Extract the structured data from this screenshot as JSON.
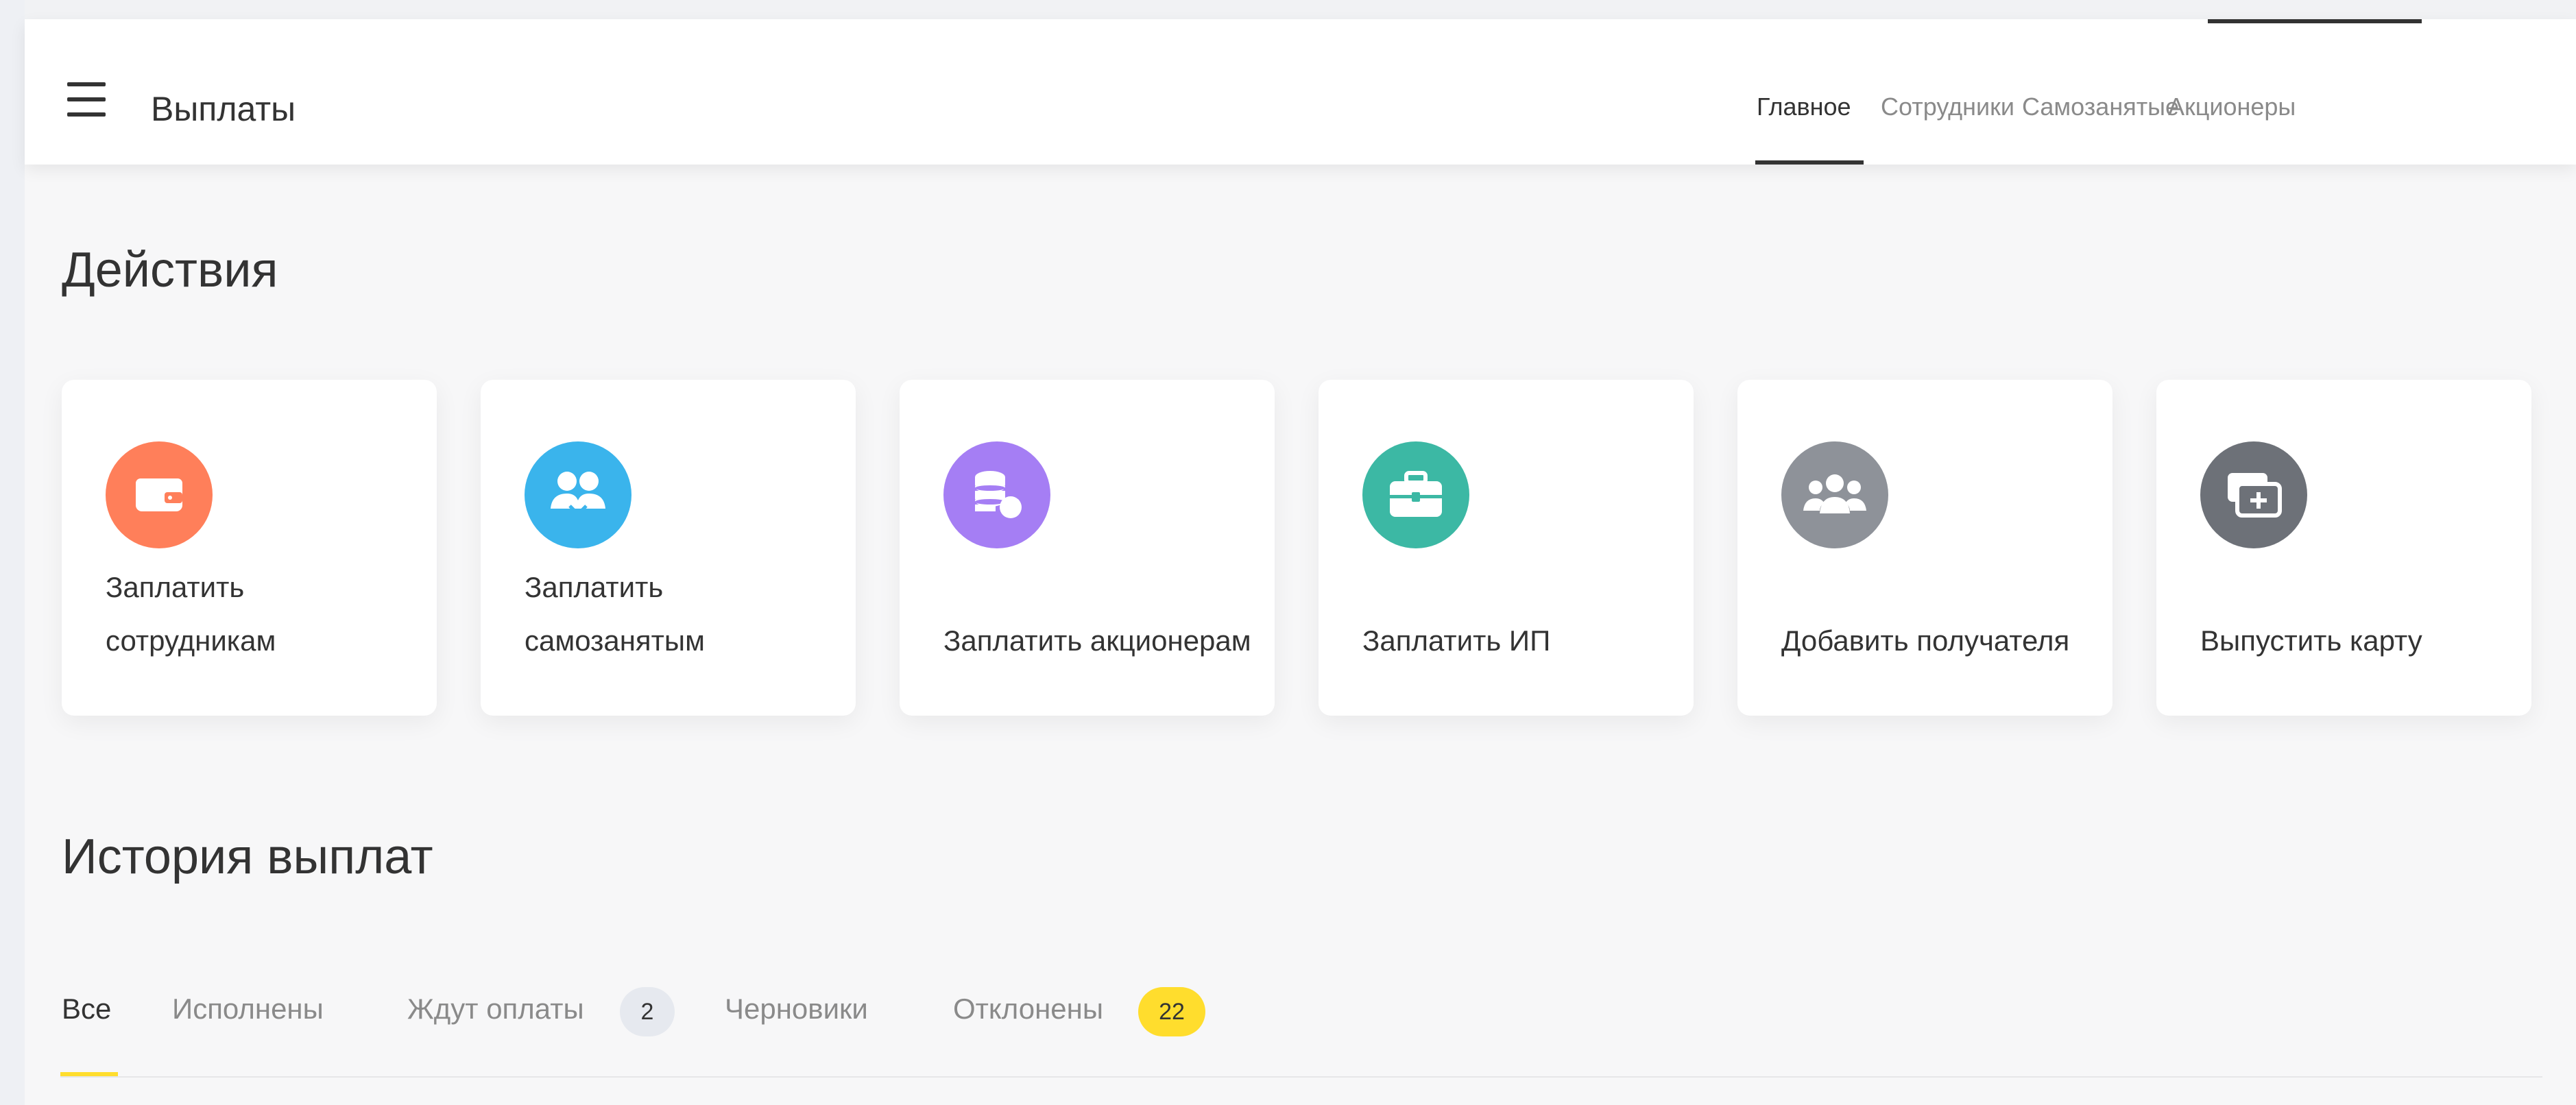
{
  "header": {
    "title": "Выплаты",
    "nav": [
      {
        "label": "Главное",
        "active": true
      },
      {
        "label": "Сотрудники",
        "active": false
      },
      {
        "label": "Самозанятые",
        "active": false
      },
      {
        "label": "Акционеры",
        "active": false
      }
    ]
  },
  "actions": {
    "title": "Действия",
    "cards": [
      {
        "label": "Заплатить сотрудникам",
        "icon": "wallet-icon",
        "color": "#ff7f5a"
      },
      {
        "label": "Заплатить самозанятым",
        "icon": "people-handshake-icon",
        "color": "#3ab4ec"
      },
      {
        "label": "Заплатить акционерам",
        "icon": "coins-stack-icon",
        "color": "#a57ef4"
      },
      {
        "label": "Заплатить ИП",
        "icon": "briefcase-icon",
        "color": "#3cb8a4"
      },
      {
        "label": "Добавить получателя",
        "icon": "group-icon",
        "color": "#8e9299"
      },
      {
        "label": "Выпустить карту",
        "icon": "add-card-icon",
        "color": "#6d7178"
      }
    ]
  },
  "history": {
    "title": "История выплат",
    "tabs": [
      {
        "label": "Все",
        "active": true
      },
      {
        "label": "Исполнены",
        "active": false
      },
      {
        "label": "Ждут оплаты",
        "active": false,
        "badge": "2",
        "badge_color": "#e6e9ef"
      },
      {
        "label": "Черновики",
        "active": false
      },
      {
        "label": "Отклонены",
        "active": false,
        "badge": "22",
        "badge_color": "#ffdd2d"
      }
    ]
  }
}
